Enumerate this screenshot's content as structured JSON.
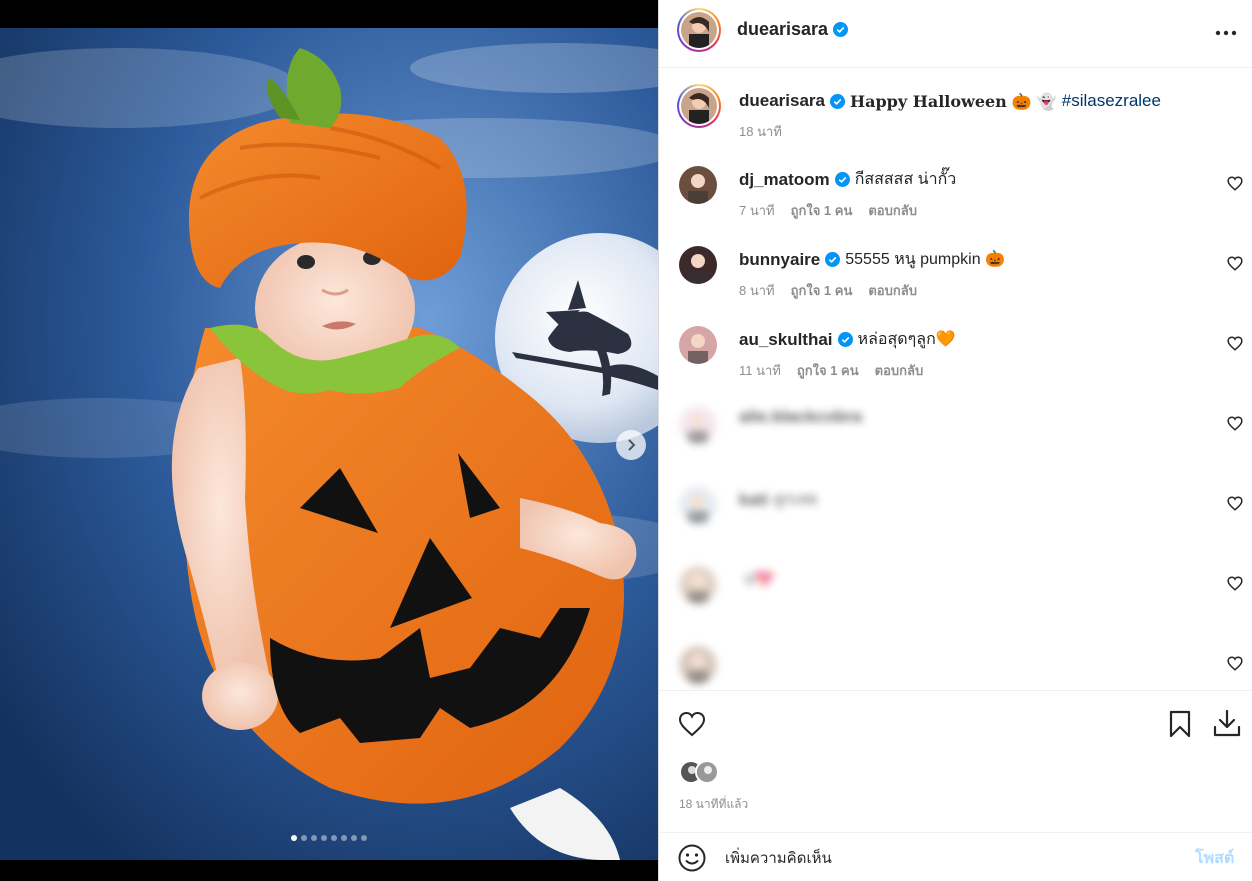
{
  "post": {
    "media": {
      "alt": "Baby in pumpkin costume on Halloween moon background",
      "slides_total": 8,
      "active_slide": 1
    },
    "header": {
      "username": "duearisara",
      "verified": true,
      "more_icon": "more-horizontal-icon"
    },
    "caption": {
      "username": "duearisara",
      "text": "Happy Halloween",
      "emojis": "🎃 👻",
      "hashtag": "#silasezralee",
      "time": "18 นาที"
    },
    "comments": [
      {
        "username": "dj_matoom",
        "text": "กีสสสสส น่ากั๊ว",
        "time": "7 นาที",
        "likes": "ถูกใจ 1 คน",
        "reply": "ตอบกลับ",
        "blurred": false
      },
      {
        "username": "bunnyaire",
        "text": "55555 หนู pumpkin 🎃",
        "time": "8 นาที",
        "likes": "ถูกใจ 1 คน",
        "reply": "ตอบกลับ",
        "blurred": false
      },
      {
        "username": "au_skulthai",
        "text": "หล่อสุดๆลูก🧡",
        "time": "11 นาที",
        "likes": "ถูกใจ 1 คน",
        "reply": "ตอบกลับ",
        "blurred": false
      },
      {
        "username": "alie.blackcobra",
        "text": "",
        "time": "",
        "likes": "",
        "reply": "",
        "blurred": true
      },
      {
        "username": "kati",
        "text": "ลูกเลย",
        "time": "",
        "likes": "",
        "reply": "",
        "blurred": true
      },
      {
        "username": "",
        "text": "ป💖",
        "time": "",
        "likes": "",
        "reply": "",
        "blurred": true
      },
      {
        "username": "",
        "text": "",
        "time": "",
        "likes": "",
        "reply": "",
        "blurred": true
      }
    ],
    "footer": {
      "likes_text": "",
      "time_ago": "18 นาทีที่แล้ว"
    },
    "add_comment": {
      "emoji_icon": "smiley-icon",
      "placeholder": "เพิ่มความคิดเห็น",
      "post_label": "โพสต์"
    }
  },
  "colors": {
    "verified": "#0095f6",
    "link": "#00376b",
    "post_button_disabled": "#b3dbff",
    "secondary_text": "#8e8e8e",
    "costume_orange": "#f07a1e"
  }
}
